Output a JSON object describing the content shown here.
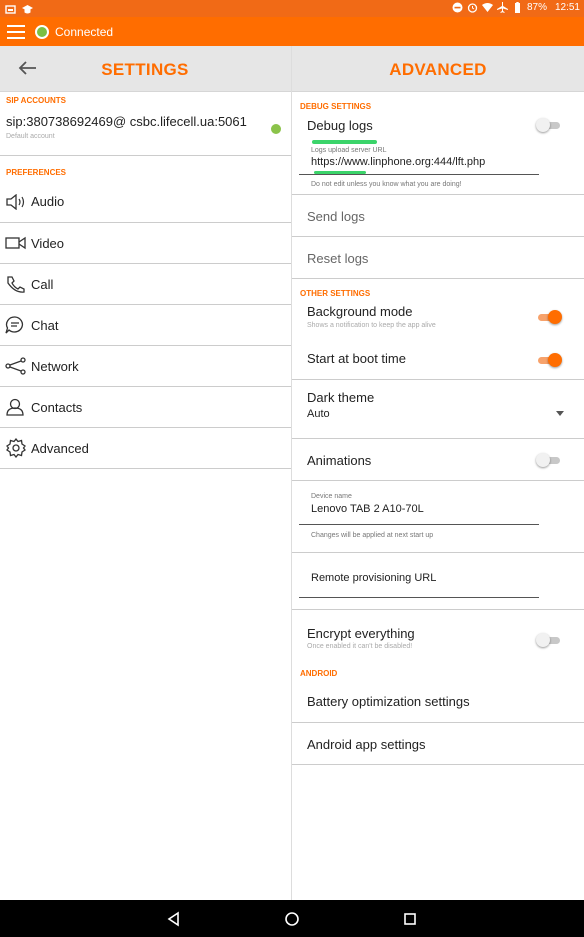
{
  "status_bar": {
    "battery": "87%",
    "time": "12:51"
  },
  "app_bar": {
    "connection_status": "Connected",
    "status_color": "#7bc043",
    "accent": "#ff6d00"
  },
  "left": {
    "title": "SETTINGS",
    "sip_section": "SIP ACCOUNTS",
    "sip_account": {
      "address": "sip:380738692469@ csbc.lifecell.ua:5061",
      "subtitle": "Default account"
    },
    "preferences_section": "PREFERENCES",
    "items": [
      {
        "label": "Audio",
        "icon": "audio-icon"
      },
      {
        "label": "Video",
        "icon": "video-icon"
      },
      {
        "label": "Call",
        "icon": "call-icon"
      },
      {
        "label": "Chat",
        "icon": "chat-icon"
      },
      {
        "label": "Network",
        "icon": "network-icon"
      },
      {
        "label": "Contacts",
        "icon": "contacts-icon"
      },
      {
        "label": "Advanced",
        "icon": "gear-icon"
      }
    ]
  },
  "right": {
    "title": "ADVANCED",
    "debug_section": "DEBUG SETTINGS",
    "debug_logs": "Debug logs",
    "logs_url_label": "Logs upload server URL",
    "logs_url_value": "https://www.linphone.org:444/lft.php",
    "logs_url_helper": "Do not edit unless you know what you are doing!",
    "send_logs": "Send logs",
    "reset_logs": "Reset logs",
    "other_section": "OTHER SETTINGS",
    "background_mode": "Background mode",
    "background_mode_desc": "Shows a notification to keep the app alive",
    "start_at_boot": "Start at boot time",
    "dark_theme": "Dark theme",
    "dark_theme_value": "Auto",
    "animations": "Animations",
    "device_name_label": "Device name",
    "device_name_value": "Lenovo TAB 2 A10-70L",
    "device_name_helper": "Changes will be applied at next start up",
    "remote_provisioning": "Remote provisioning URL",
    "encrypt": "Encrypt everything",
    "encrypt_desc": "Once enabled it can't be disabled!",
    "android_section": "ANDROID",
    "battery_opt": "Battery optimization settings",
    "android_app_settings": "Android app settings"
  }
}
